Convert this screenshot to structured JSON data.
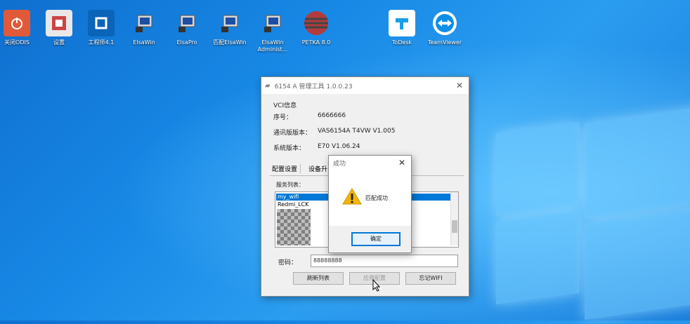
{
  "desktop": {
    "icons": [
      {
        "label": "关闭ODIS",
        "icon": "power-icon",
        "color": "#e05a3a"
      },
      {
        "label": "设置",
        "icon": "tools-icon",
        "color": "#e8e8e8"
      },
      {
        "label": "工程师4.1",
        "icon": "engineer-app-icon",
        "color": "#0a64b8"
      },
      {
        "label": "ElsaWin",
        "icon": "computer-icon",
        "color": "#d8d8d8"
      },
      {
        "label": "ElsaPro",
        "icon": "computer-icon",
        "color": "#d8d8d8"
      },
      {
        "label": "匹配ElsaWin",
        "icon": "computer-icon",
        "color": "#d8d8d8"
      },
      {
        "label": "ElsaWin Administ...",
        "icon": "computer-icon",
        "color": "#d8d8d8"
      },
      {
        "label": "PETKA 8.0",
        "icon": "globe-icon",
        "color": "#b33b3b"
      },
      {
        "label": "ToDesk",
        "icon": "todesk-icon",
        "color": "#1aa0e8"
      },
      {
        "label": "TeamViewer",
        "icon": "teamviewer-icon",
        "color": "#0e8ee9"
      }
    ]
  },
  "main_window": {
    "title": "6154 A 管理工具 1.0.0.23",
    "vci_section": "VCI信息",
    "rows": [
      {
        "label": "序号：",
        "value": "6666666"
      },
      {
        "label": "通讯版版本：",
        "value": "VAS6154A T4VW V1.005"
      },
      {
        "label": "系统版本：",
        "value": "E70 V1.06.24"
      }
    ],
    "tabs": [
      "配置设置",
      "设备升"
    ],
    "list_label": "服务列表：",
    "list_items": [
      "my_wifi",
      "Redmi_LCK"
    ],
    "password_label": "密码：",
    "password_value": "88888888",
    "buttons": [
      "刷新列表",
      "应用配置",
      "忘记WIFI"
    ]
  },
  "dialog": {
    "title": "成功",
    "message": "匹配成功",
    "ok_label": "确定"
  },
  "colors": {
    "accent": "#0078d7",
    "warning": "#f2b600"
  }
}
